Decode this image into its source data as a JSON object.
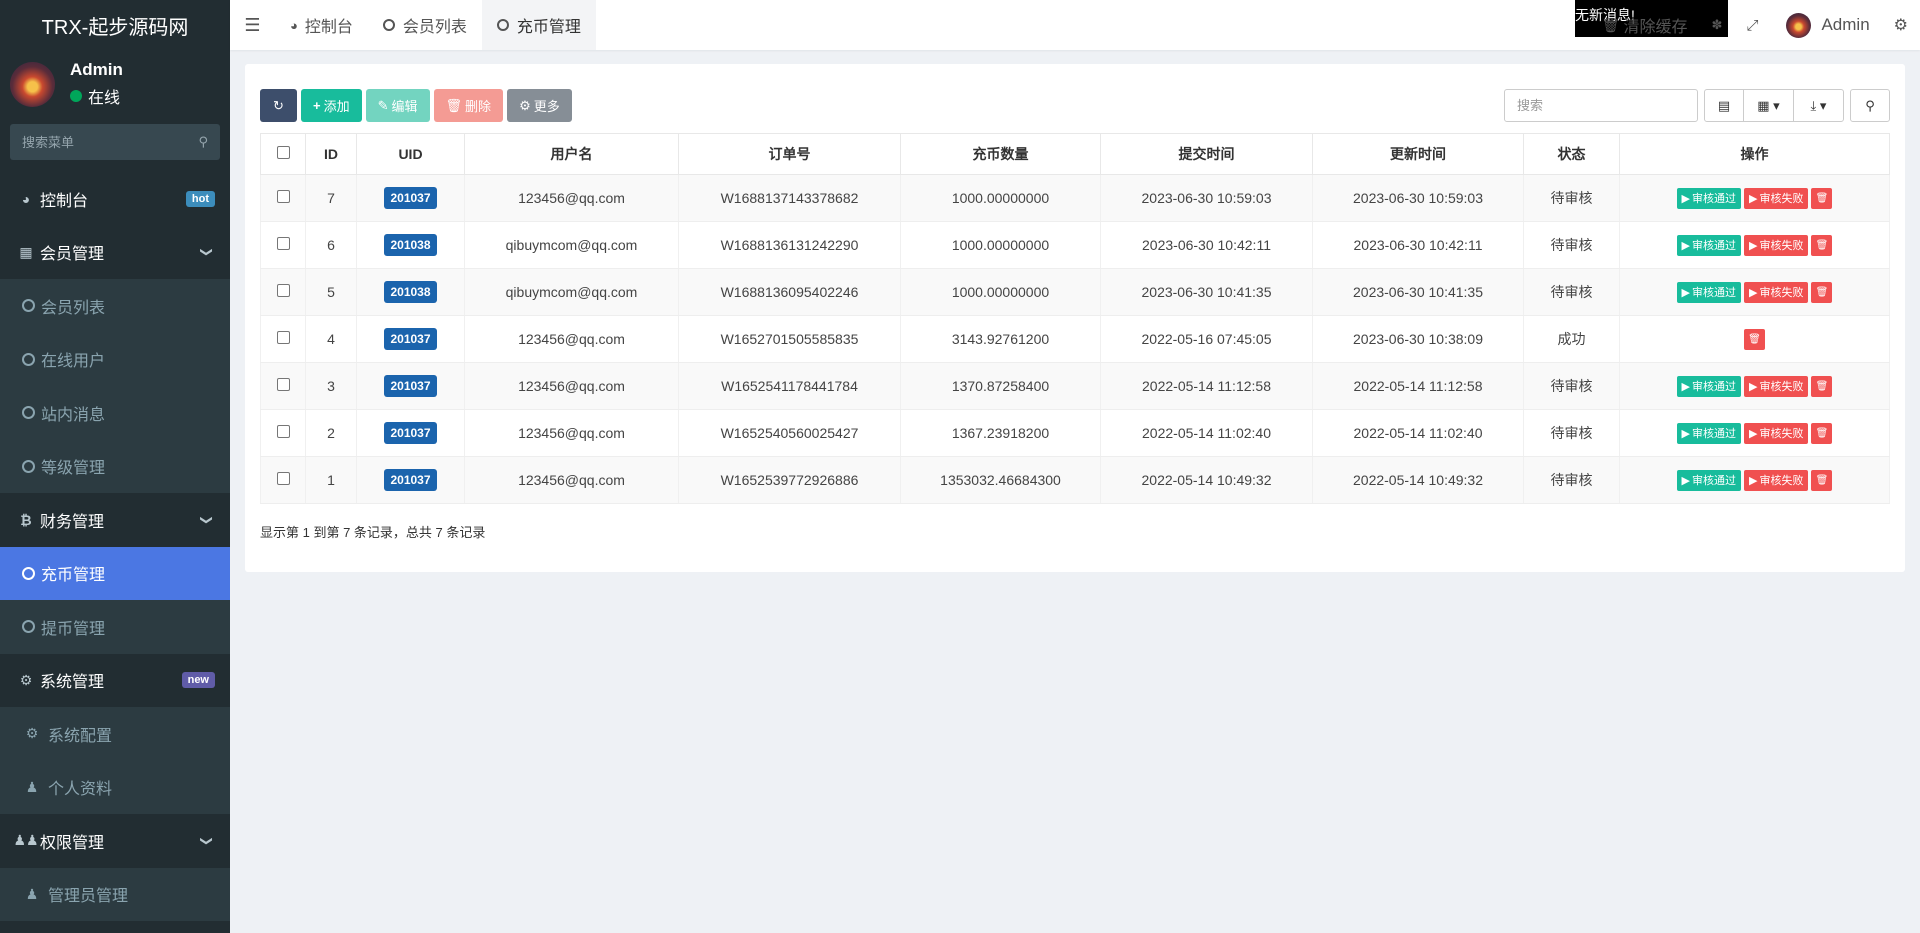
{
  "app": {
    "title": "TRX-起步源码网"
  },
  "user": {
    "name": "Admin",
    "status": "在线"
  },
  "sidebar": {
    "search_placeholder": "搜索菜单",
    "items": [
      {
        "label": "控制台",
        "badge": "hot"
      },
      {
        "label": "会员管理"
      },
      {
        "label": "会员列表"
      },
      {
        "label": "在线用户"
      },
      {
        "label": "站内消息"
      },
      {
        "label": "等级管理"
      },
      {
        "label": "财务管理"
      },
      {
        "label": "充币管理"
      },
      {
        "label": "提币管理"
      },
      {
        "label": "系统管理",
        "badge": "new"
      },
      {
        "label": "系统配置"
      },
      {
        "label": "个人资料"
      },
      {
        "label": "权限管理"
      },
      {
        "label": "管理员管理"
      }
    ]
  },
  "header": {
    "tabs": [
      {
        "label": "控制台"
      },
      {
        "label": "会员列表"
      },
      {
        "label": "充币管理"
      }
    ],
    "notice": "暂无新消息!",
    "clear_cache": "清除缓存",
    "admin": "Admin"
  },
  "toolbar": {
    "add": "添加",
    "edit": "编辑",
    "delete": "删除",
    "more": "更多",
    "search_placeholder": "搜索"
  },
  "table": {
    "columns": [
      "ID",
      "UID",
      "用户名",
      "订单号",
      "充币数量",
      "提交时间",
      "更新时间",
      "状态",
      "操作"
    ],
    "approve_label": "审核通过",
    "reject_label": "审核失败",
    "rows": [
      {
        "id": "7",
        "uid": "201037",
        "username": "123456@qq.com",
        "order": "W1688137143378682",
        "amount": "1000.00000000",
        "submitted": "2023-06-30 10:59:03",
        "updated": "2023-06-30 10:59:03",
        "status": "待审核"
      },
      {
        "id": "6",
        "uid": "201038",
        "username": "qibuymcom@qq.com",
        "order": "W1688136131242290",
        "amount": "1000.00000000",
        "submitted": "2023-06-30 10:42:11",
        "updated": "2023-06-30 10:42:11",
        "status": "待审核"
      },
      {
        "id": "5",
        "uid": "201038",
        "username": "qibuymcom@qq.com",
        "order": "W1688136095402246",
        "amount": "1000.00000000",
        "submitted": "2023-06-30 10:41:35",
        "updated": "2023-06-30 10:41:35",
        "status": "待审核"
      },
      {
        "id": "4",
        "uid": "201037",
        "username": "123456@qq.com",
        "order": "W1652701505585835",
        "amount": "3143.92761200",
        "submitted": "2022-05-16 07:45:05",
        "updated": "2023-06-30 10:38:09",
        "status": "成功"
      },
      {
        "id": "3",
        "uid": "201037",
        "username": "123456@qq.com",
        "order": "W1652541178441784",
        "amount": "1370.87258400",
        "submitted": "2022-05-14 11:12:58",
        "updated": "2022-05-14 11:12:58",
        "status": "待审核"
      },
      {
        "id": "2",
        "uid": "201037",
        "username": "123456@qq.com",
        "order": "W1652540560025427",
        "amount": "1367.23918200",
        "submitted": "2022-05-14 11:02:40",
        "updated": "2022-05-14 11:02:40",
        "status": "待审核"
      },
      {
        "id": "1",
        "uid": "201037",
        "username": "123456@qq.com",
        "order": "W1652539772926886",
        "amount": "1353032.46684300",
        "submitted": "2022-05-14 10:49:32",
        "updated": "2022-05-14 10:49:32",
        "status": "待审核"
      }
    ]
  },
  "pagination": {
    "summary": "显示第 1 到第 7 条记录，总共 7 条记录"
  },
  "colors": {
    "sidebar_bg": "#222d32",
    "active_menu": "#4b77e3",
    "success": "#18bc9c",
    "danger": "#f05050",
    "uid_badge": "#1b64ad"
  }
}
